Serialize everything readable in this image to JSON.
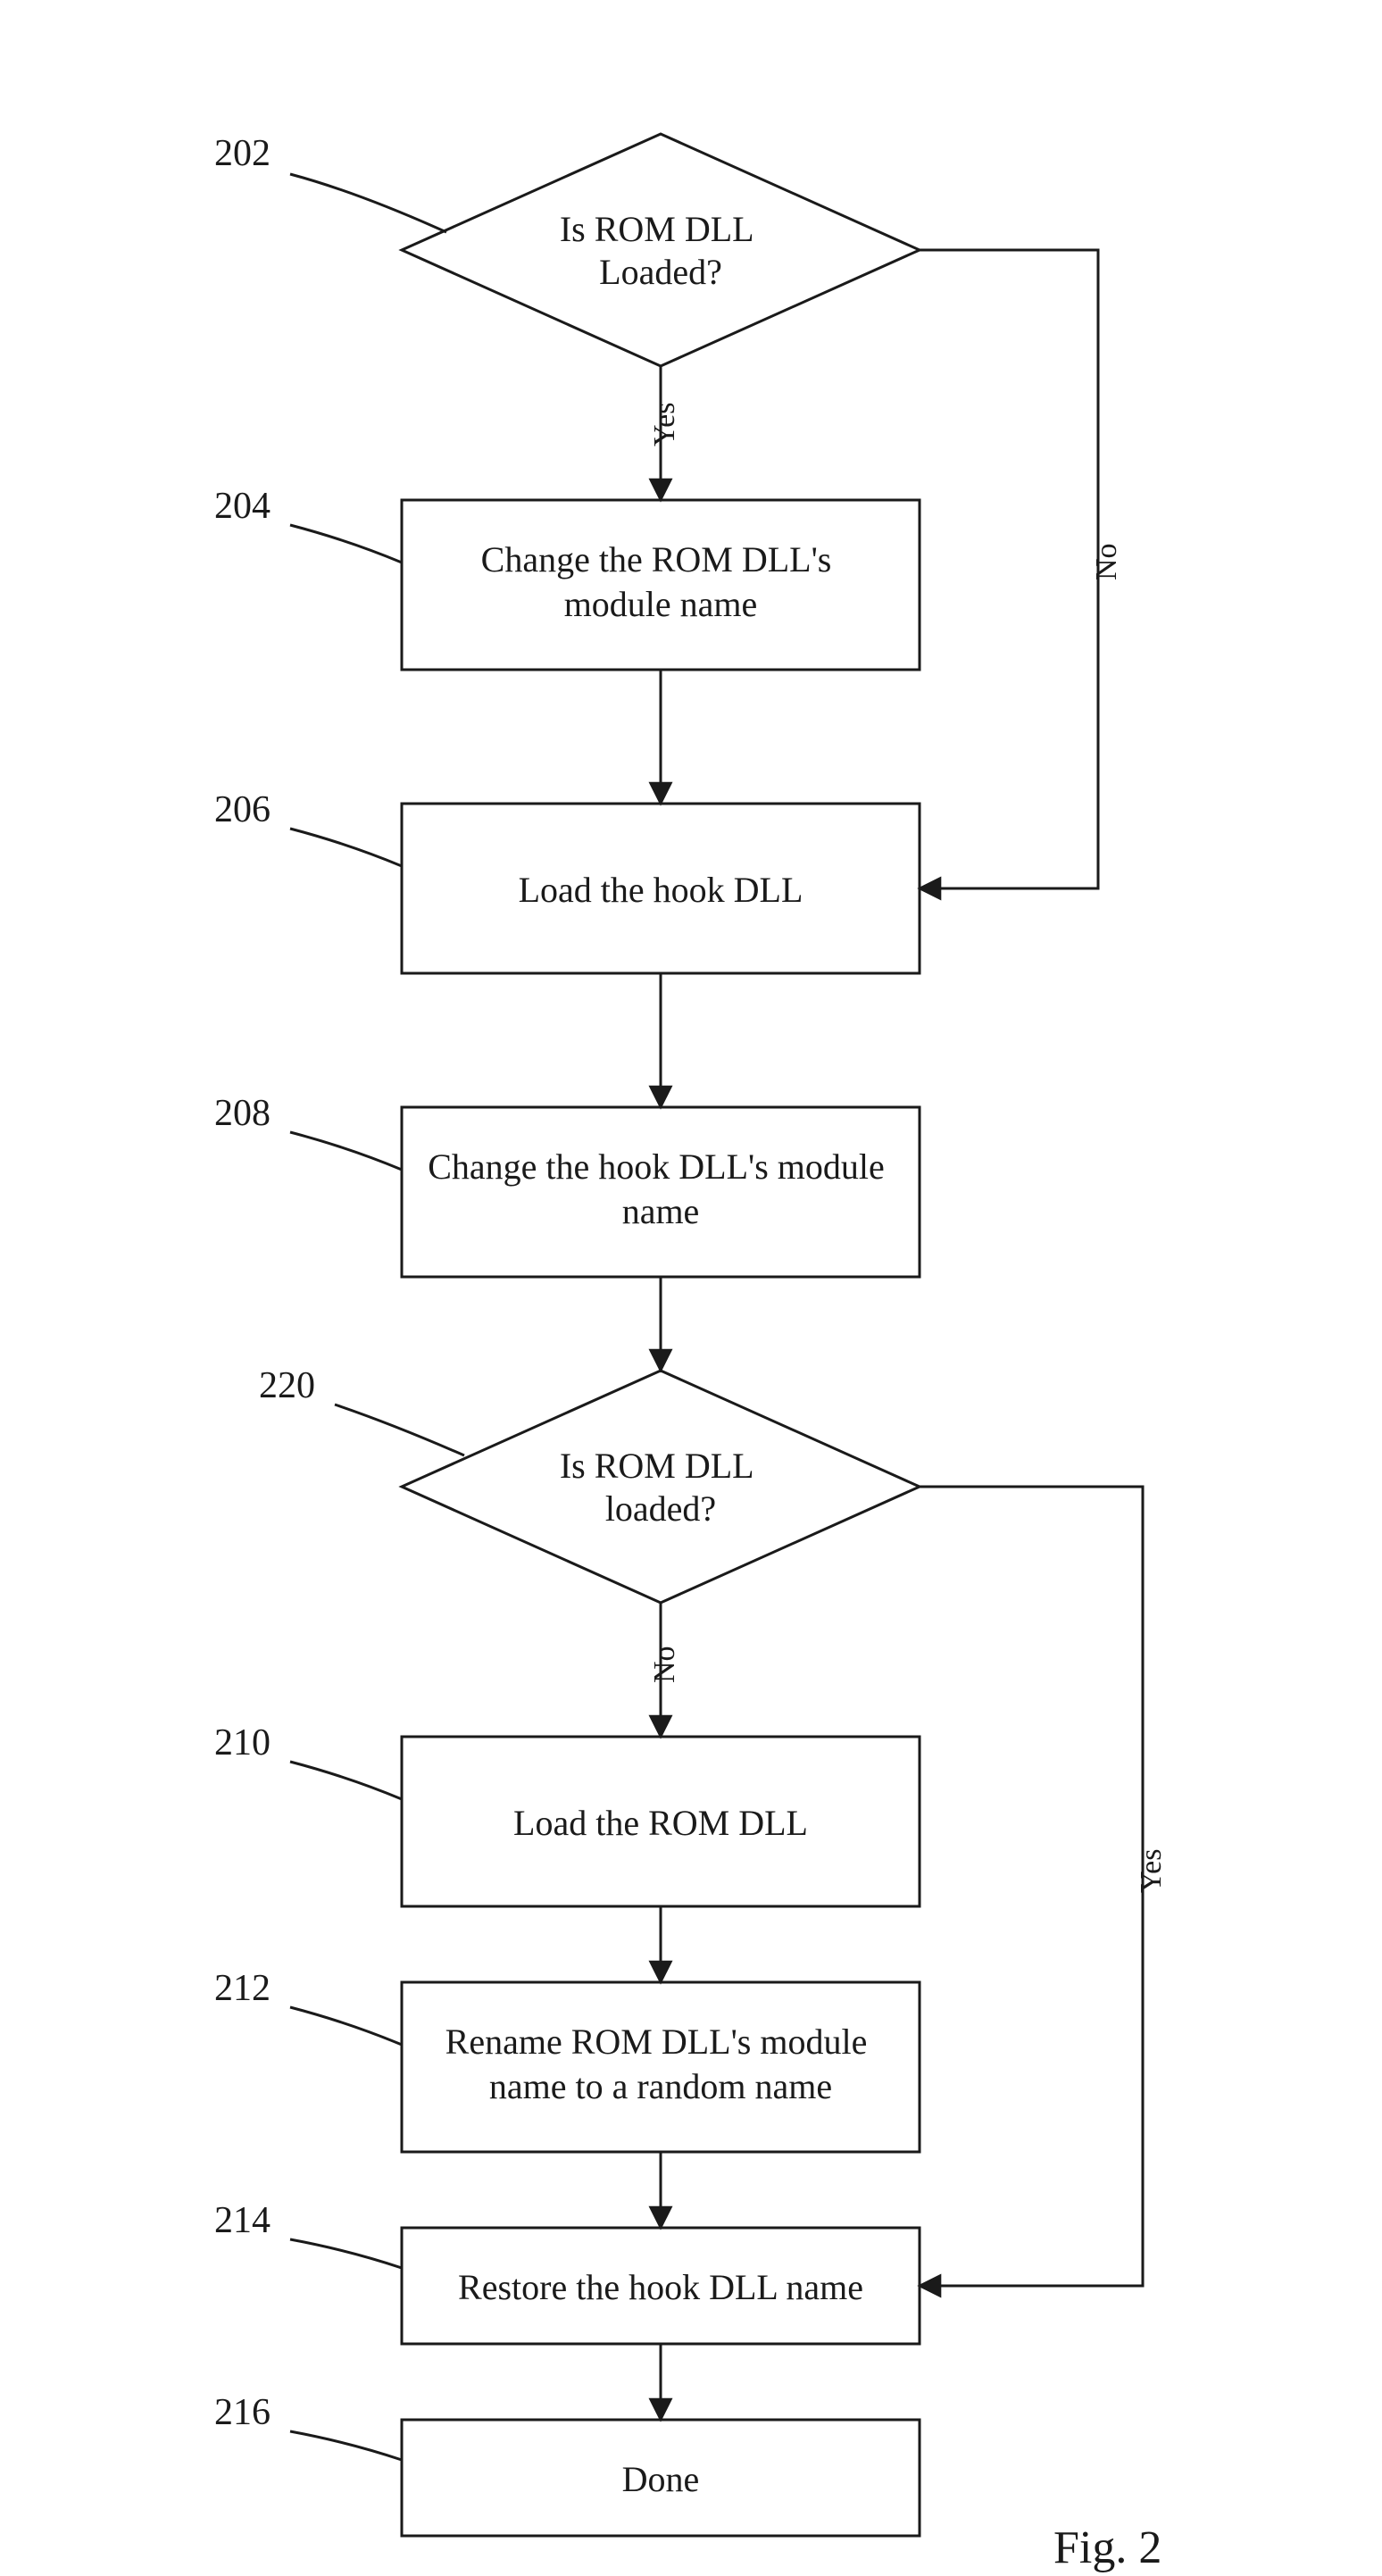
{
  "chart_data": {
    "type": "flowchart",
    "caption": "Fig. 2",
    "nodes": [
      {
        "id": "202",
        "ref": "202",
        "kind": "decision",
        "text_lines": [
          "Is ROM DLL",
          "Loaded?"
        ]
      },
      {
        "id": "204",
        "ref": "204",
        "kind": "process",
        "text_lines": [
          "Change the ROM DLL's",
          "module name"
        ]
      },
      {
        "id": "206",
        "ref": "206",
        "kind": "process",
        "text_lines": [
          "Load the hook DLL"
        ]
      },
      {
        "id": "208",
        "ref": "208",
        "kind": "process",
        "text_lines": [
          "Change the hook DLL's module",
          "name"
        ]
      },
      {
        "id": "220",
        "ref": "220",
        "kind": "decision",
        "text_lines": [
          "Is ROM DLL",
          "loaded?"
        ]
      },
      {
        "id": "210",
        "ref": "210",
        "kind": "process",
        "text_lines": [
          "Load the ROM DLL"
        ]
      },
      {
        "id": "212",
        "ref": "212",
        "kind": "process",
        "text_lines": [
          "Rename ROM DLL's module",
          "name to a random name"
        ]
      },
      {
        "id": "214",
        "ref": "214",
        "kind": "process",
        "text_lines": [
          "Restore the hook DLL name"
        ]
      },
      {
        "id": "216",
        "ref": "216",
        "kind": "process",
        "text_lines": [
          "Done"
        ]
      }
    ],
    "edges": [
      {
        "from": "202",
        "to": "204",
        "label": "Yes"
      },
      {
        "from": "202",
        "to": "206",
        "label": "No"
      },
      {
        "from": "204",
        "to": "206",
        "label": ""
      },
      {
        "from": "206",
        "to": "208",
        "label": ""
      },
      {
        "from": "208",
        "to": "220",
        "label": ""
      },
      {
        "from": "220",
        "to": "210",
        "label": "No"
      },
      {
        "from": "220",
        "to": "214",
        "label": "Yes"
      },
      {
        "from": "210",
        "to": "212",
        "label": ""
      },
      {
        "from": "212",
        "to": "214",
        "label": ""
      },
      {
        "from": "214",
        "to": "216",
        "label": ""
      }
    ]
  }
}
